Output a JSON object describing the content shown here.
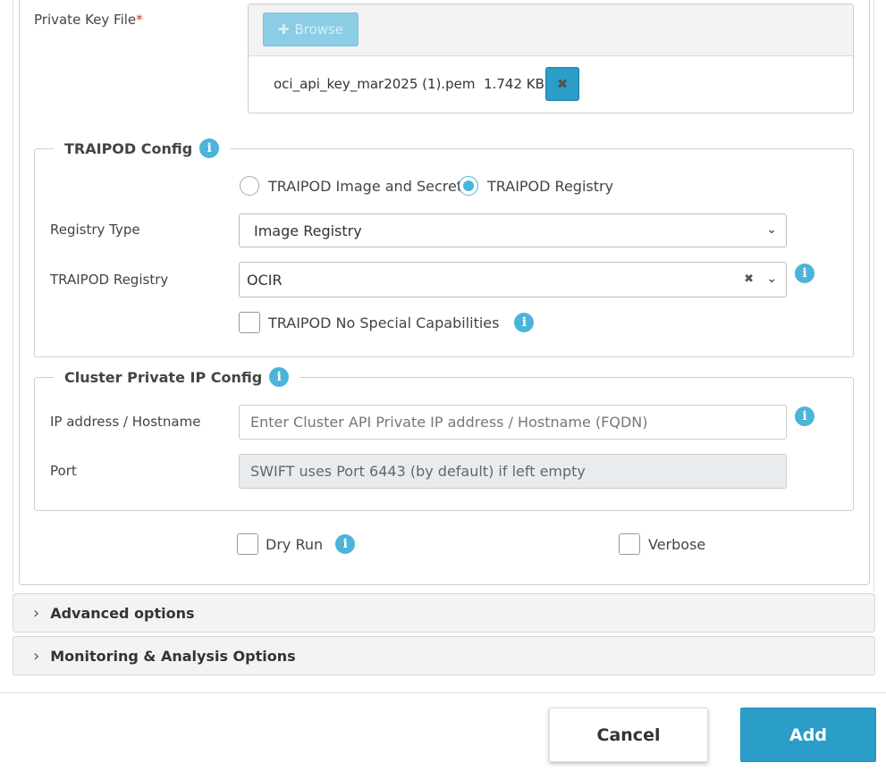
{
  "private_key": {
    "label": "Private Key File",
    "required_mark": "*",
    "browse_label": "Browse",
    "file_name": "oci_api_key_mar2025 (1).pem",
    "file_size": "1.742 KB",
    "remove_icon": "close-icon"
  },
  "traipod_config": {
    "legend": "TRAIPOD Config",
    "radio_options": [
      {
        "label": "TRAIPOD Image and Secret",
        "checked": false
      },
      {
        "label": "TRAIPOD Registry",
        "checked": true
      }
    ],
    "registry_type_label": "Registry Type",
    "registry_type_value": "Image Registry",
    "registry_label": "TRAIPOD Registry",
    "registry_value": "OCIR",
    "no_special_caps_label": "TRAIPOD No Special Capabilities"
  },
  "cluster_config": {
    "legend": "Cluster Private IP Config",
    "ip_label": "IP address / Hostname",
    "ip_placeholder": "Enter Cluster API Private IP address / Hostname (FQDN)",
    "port_label": "Port",
    "port_placeholder": "SWIFT uses Port 6443 (by default) if left empty"
  },
  "options": {
    "dry_run_label": "Dry Run",
    "verbose_label": "Verbose"
  },
  "accordions": [
    {
      "label": "Advanced options"
    },
    {
      "label": "Monitoring & Analysis Options"
    }
  ],
  "footer": {
    "cancel_label": "Cancel",
    "add_label": "Add"
  },
  "colors": {
    "accent": "#2a9dc8",
    "info": "#4bb4d8",
    "required": "#c9302c"
  }
}
